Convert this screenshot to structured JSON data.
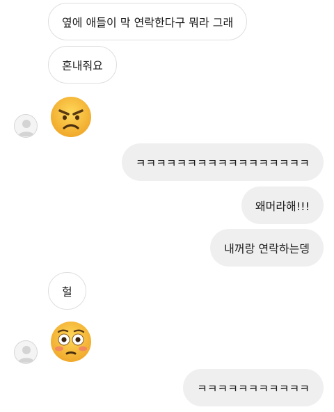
{
  "messages": [
    {
      "side": "in",
      "type": "text",
      "text": "옆에 애들이 막 연락한다구 뭐라 그래"
    },
    {
      "side": "in",
      "type": "text",
      "text": "혼내줘요"
    },
    {
      "side": "in",
      "type": "emoji",
      "emoji": "angry-face",
      "avatar": true
    },
    {
      "side": "out",
      "type": "text",
      "text": "ㅋㅋㅋㅋㅋㅋㅋㅋㅋㅋㅋㅋㅋㅋㅋㅋㅋ"
    },
    {
      "side": "out",
      "type": "text",
      "text": "왜머라해!!!"
    },
    {
      "side": "out",
      "type": "text",
      "text": "내꺼랑 연락하는뎅"
    },
    {
      "side": "in",
      "type": "text",
      "text": "헐"
    },
    {
      "side": "in",
      "type": "emoji",
      "emoji": "flushed-face",
      "avatar": true
    },
    {
      "side": "out",
      "type": "text",
      "text": "ㅋㅋㅋㅋㅋㅋㅋㅋㅋㅋㅋ"
    }
  ],
  "colors": {
    "incoming_bubble": "#ffffff",
    "incoming_border": "#dedede",
    "outgoing_bubble": "#efefef",
    "text": "#1a1a1a",
    "emoji_yellow": "#f8c53a"
  }
}
